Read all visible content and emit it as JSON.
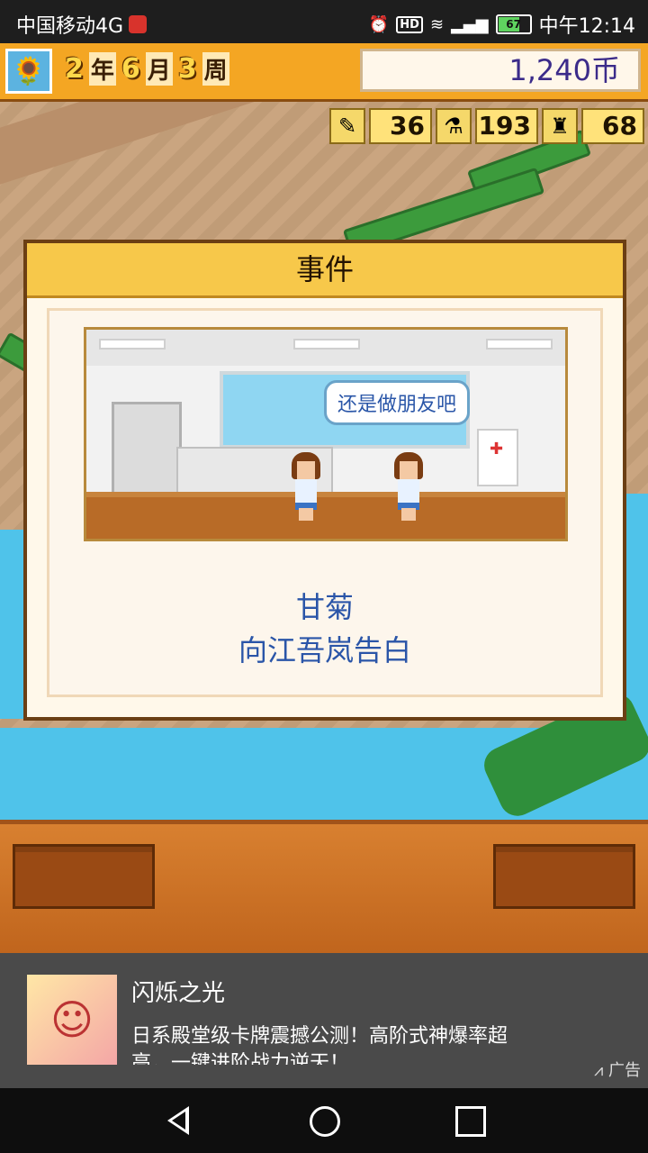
{
  "status_bar": {
    "carrier": "中国移动4G",
    "time": "中午12:14",
    "battery": "67",
    "hd": "HD",
    "network": "4G"
  },
  "hud": {
    "date_year": "2",
    "date_year_unit": "年",
    "date_month": "6",
    "date_month_unit": "月",
    "date_week": "3",
    "date_week_unit": "周",
    "money": "1,240币",
    "stats": [
      {
        "icon": "pencil-icon",
        "value": "36"
      },
      {
        "icon": "flask-icon",
        "value": "193"
      },
      {
        "icon": "tower-icon",
        "value": "68"
      }
    ]
  },
  "dialog": {
    "title": "事件",
    "speech": "还是做朋友吧",
    "line1": "甘菊",
    "line2": "向江吾岚告白"
  },
  "ad": {
    "title": "闪烁之光",
    "description": "日系殿堂级卡牌震撼公测！高阶式神爆率超高，一键进阶战力逆天！",
    "tag": "广告"
  }
}
